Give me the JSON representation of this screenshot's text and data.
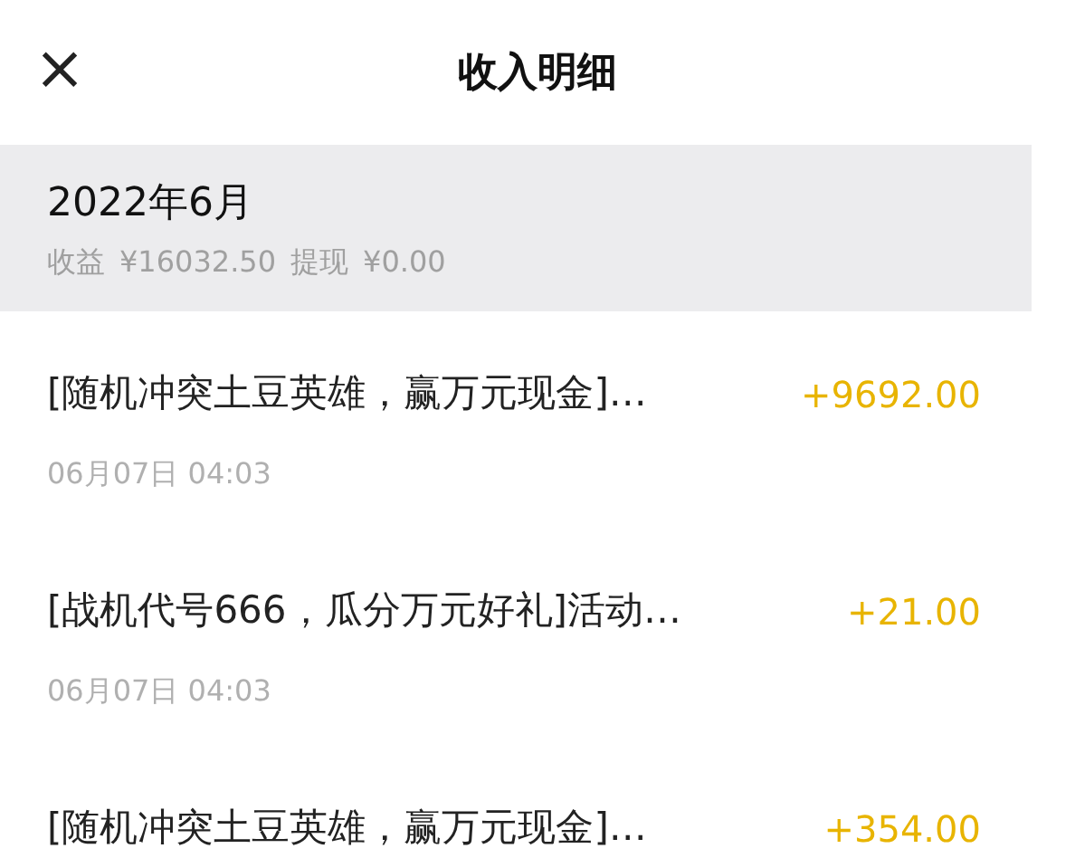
{
  "header": {
    "close": "×",
    "title": "收入明细"
  },
  "summary": {
    "month": "2022年6月",
    "income_label": "收益",
    "income": "¥16032.50",
    "withdraw_label": "提现",
    "withdraw": "¥0.00"
  },
  "records": [
    {
      "title": "[随机冲突土豆英雄，赢万元现金]…",
      "amount": "+9692.00",
      "time": "06月07日 04:03"
    },
    {
      "title": "[战机代号666，瓜分万元好礼]活动…",
      "amount": "+21.00",
      "time": "06月07日 04:03"
    },
    {
      "title": "[随机冲突土豆英雄，赢万元现金]…",
      "amount": "+354.00"
    }
  ]
}
